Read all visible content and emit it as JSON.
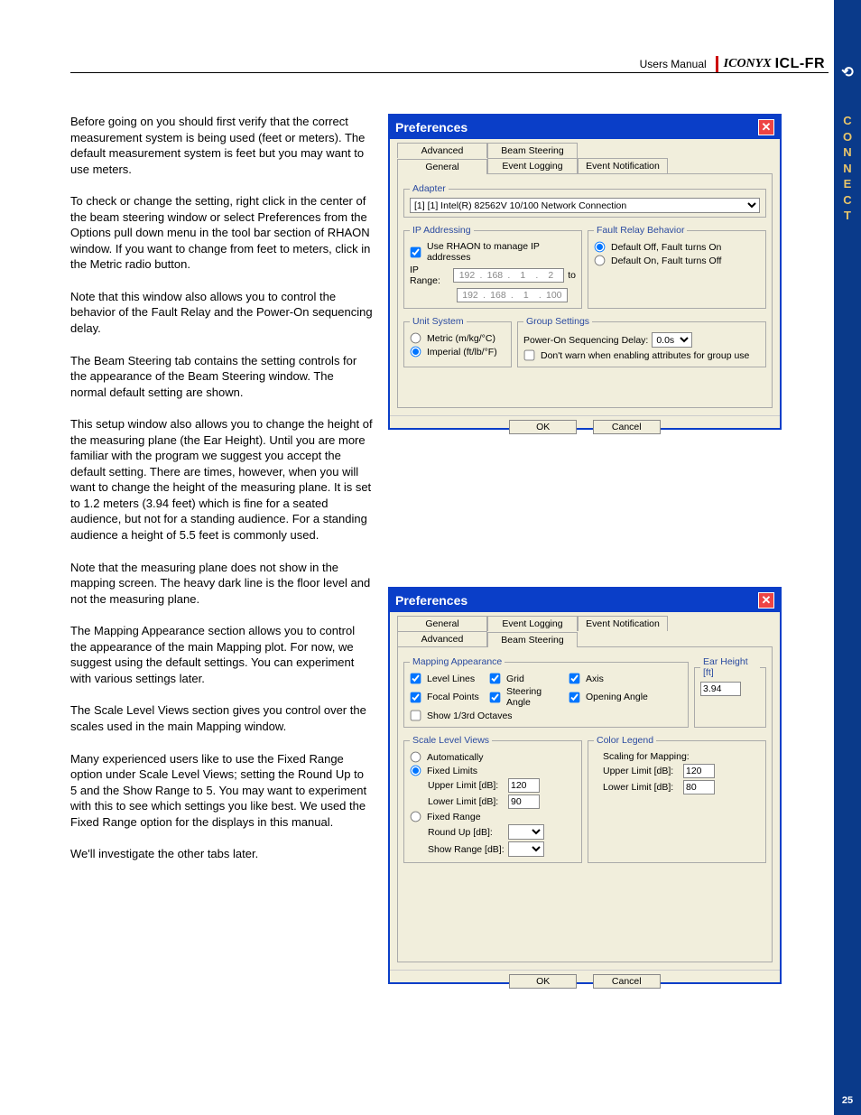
{
  "header": {
    "users_manual": "Users Manual",
    "logo_iconyx": "ICONYX",
    "logo_model": "ICL-FR"
  },
  "side": {
    "letters": [
      "C",
      "O",
      "N",
      "N",
      "E",
      "C",
      "T"
    ],
    "page": "25",
    "icon": "⟲"
  },
  "paragraphs": [
    "Before going on you should first verify that the correct measurement system is being used (feet or meters). The default measurement system is feet but you may want to use meters.",
    "To check or change the setting, right click in the center of the beam steering window or select Preferences from the Options pull down menu in the tool bar section of RHAON window. If you want to change from feet to meters, click in the Metric radio button.",
    "Note that this window also allows you to control the behavior of the Fault Relay and the Power-On sequencing delay.",
    "The Beam Steering tab contains the setting controls for the appearance of the Beam Steering window. The normal default setting are shown.",
    "This setup window also allows you to change the height of the measuring plane (the Ear Height).  Until you are more familiar with the program we suggest you accept the default setting. There are times, however, when you will want to change the height of the measuring plane. It is set to 1.2 meters (3.94 feet) which is fine for a seated audience, but not for a standing audience. For a standing audience a height of 5.5 feet is commonly used.",
    "Note that the measuring plane does not show in the mapping screen. The heavy dark line is the floor level and not the measuring plane.",
    "The Mapping Appearance section allows you to control the appearance of the main Mapping plot. For now, we suggest using the default settings. You can experiment with various settings later.",
    "The Scale Level Views section  gives you control over the scales used in the main Mapping window.",
    "Many experienced users like to use the Fixed Range option under Scale Level Views; setting  the Round Up to 5 and the Show Range to 5. You may want to experiment with this to see which settings you like best. We used the Fixed Range option for the displays in this manual.",
    "We'll investigate the other tabs later."
  ],
  "dlg1": {
    "title": "Preferences",
    "tabs_row1": [
      "Advanced",
      "Beam Steering"
    ],
    "tabs_row2": [
      "General",
      "Event Logging",
      "Event Notification"
    ],
    "adapter": {
      "legend": "Adapter",
      "value": "[1] [1] Intel(R) 82562V 10/100 Network Connection"
    },
    "ip": {
      "legend": "IP Addressing",
      "use_rhaon": "Use RHAON to manage IP addresses",
      "range_label": "IP Range:",
      "to": "to",
      "ip_from": [
        "192",
        "168",
        "1",
        "2"
      ],
      "ip_to": [
        "192",
        "168",
        "1",
        "100"
      ]
    },
    "fault": {
      "legend": "Fault Relay Behavior",
      "off": "Default Off, Fault turns On",
      "on": "Default On, Fault turns Off"
    },
    "unit": {
      "legend": "Unit System",
      "metric": "Metric (m/kg/°C)",
      "imperial": "Imperial (ft/lb/°F)"
    },
    "group": {
      "legend": "Group Settings",
      "delay_label": "Power-On Sequencing Delay:",
      "delay_value": "0.0s",
      "dont_warn": "Don't warn when enabling attributes for group use"
    },
    "ok": "OK",
    "cancel": "Cancel"
  },
  "dlg2": {
    "title": "Preferences",
    "tabs_row1": [
      "General",
      "Event Logging",
      "Event Notification"
    ],
    "tabs_row2": [
      "Advanced",
      "Beam Steering"
    ],
    "mapping": {
      "legend": "Mapping Appearance",
      "level_lines": "Level Lines",
      "grid": "Grid",
      "axis": "Axis",
      "focal_points": "Focal Points",
      "steering_angle": "Steering Angle",
      "opening_angle": "Opening Angle",
      "show_octaves": "Show 1/3rd Octaves"
    },
    "ear": {
      "legend": "Ear Height [ft]",
      "value": "3.94"
    },
    "scale": {
      "legend": "Scale Level Views",
      "auto": "Automatically",
      "fixed_limits": "Fixed Limits",
      "upper_label": "Upper Limit [dB]:",
      "upper_value": "120",
      "lower_label": "Lower Limit [dB]:",
      "lower_value": "90",
      "fixed_range": "Fixed Range",
      "roundup_label": "Round Up [dB]:",
      "showrange_label": "Show Range [dB]:"
    },
    "color": {
      "legend": "Color Legend",
      "scaling": "Scaling for Mapping:",
      "upper_label": "Upper Limit [dB]:",
      "upper_value": "120",
      "lower_label": "Lower Limit [dB]:",
      "lower_value": "80"
    },
    "ok": "OK",
    "cancel": "Cancel"
  }
}
